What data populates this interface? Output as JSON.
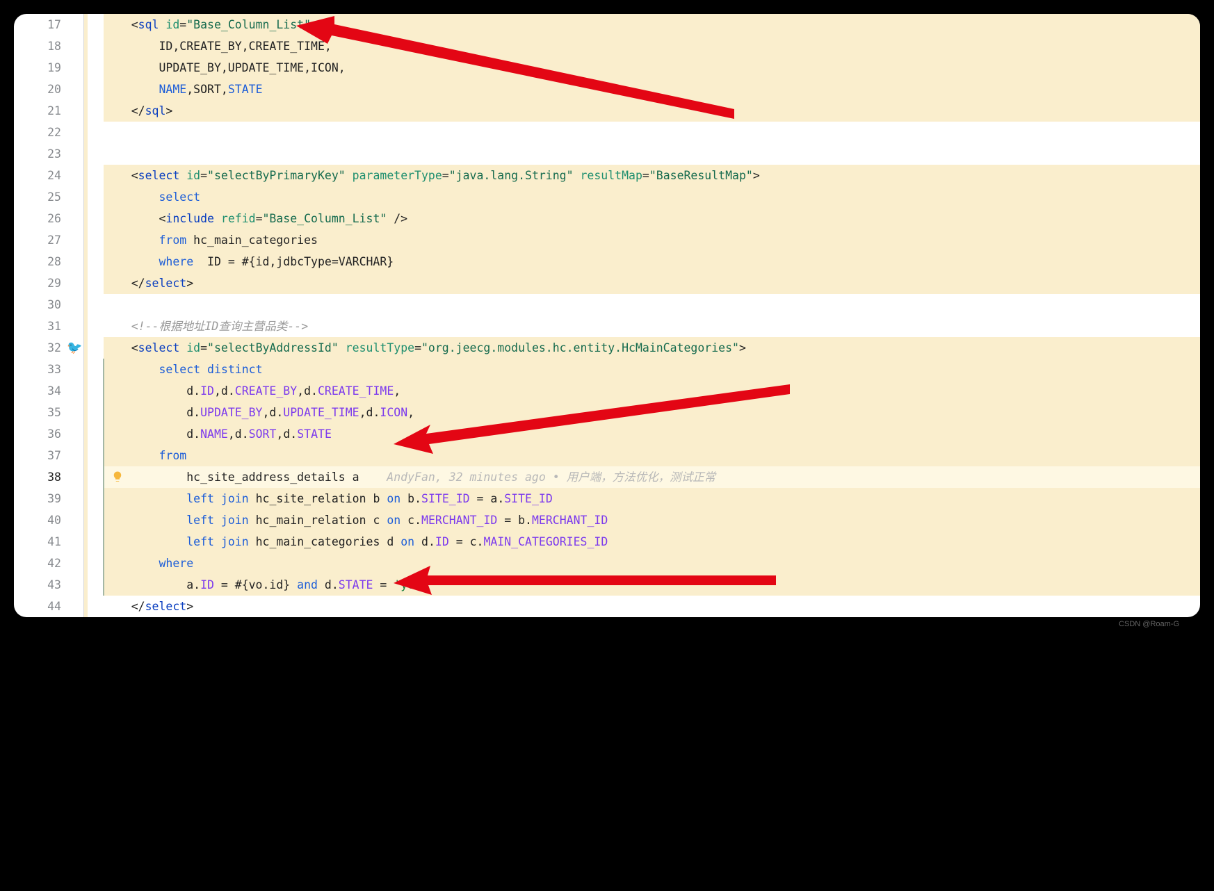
{
  "watermark": "CSDN @Roam-G",
  "gutter": {
    "start": 17,
    "end": 44,
    "bird_line": 32,
    "bulb_line": 38,
    "highlighted_ranges": [
      [
        17,
        21
      ],
      [
        24,
        29
      ],
      [
        32,
        44
      ]
    ],
    "current_line": 38
  },
  "blame": {
    "author": "AndyFan",
    "time": "32 minutes ago",
    "message": "用户端，方法优化，测试正常"
  },
  "code": {
    "lines": [
      {
        "n": 17,
        "hl": 1,
        "tokens": [
          [
            "    <",
            "text"
          ],
          [
            "sql",
            "tag"
          ],
          [
            " ",
            "text"
          ],
          [
            "id",
            "attr"
          ],
          [
            "=",
            "text"
          ],
          [
            "\"Base_Column_List\"",
            "str"
          ],
          [
            ">",
            "text"
          ]
        ]
      },
      {
        "n": 18,
        "hl": 1,
        "tokens": [
          [
            "        ID,CREATE_BY,CREATE_TIME,",
            "text"
          ]
        ]
      },
      {
        "n": 19,
        "hl": 1,
        "tokens": [
          [
            "        UPDATE_BY,UPDATE_TIME,ICON,",
            "text"
          ]
        ]
      },
      {
        "n": 20,
        "hl": 1,
        "tokens": [
          [
            "        ",
            "text"
          ],
          [
            "NAME",
            "kw"
          ],
          [
            ",SORT,",
            "text"
          ],
          [
            "STATE",
            "kw"
          ]
        ]
      },
      {
        "n": 21,
        "hl": 1,
        "tokens": [
          [
            "    </",
            "text"
          ],
          [
            "sql",
            "tag"
          ],
          [
            ">",
            "text"
          ]
        ]
      },
      {
        "n": 22,
        "hl": 0,
        "tokens": [
          [
            "",
            "text"
          ]
        ]
      },
      {
        "n": 23,
        "hl": 0,
        "tokens": [
          [
            "",
            "text"
          ]
        ]
      },
      {
        "n": 24,
        "hl": 1,
        "tokens": [
          [
            "    <",
            "text"
          ],
          [
            "select",
            "tag"
          ],
          [
            " ",
            "text"
          ],
          [
            "id",
            "attr"
          ],
          [
            "=",
            "text"
          ],
          [
            "\"selectByPrimaryKey\"",
            "str"
          ],
          [
            " ",
            "text"
          ],
          [
            "parameterType",
            "attr"
          ],
          [
            "=",
            "text"
          ],
          [
            "\"java.lang.String\"",
            "str"
          ],
          [
            " ",
            "text"
          ],
          [
            "resultMap",
            "attr"
          ],
          [
            "=",
            "text"
          ],
          [
            "\"BaseResultMap\"",
            "str"
          ],
          [
            ">",
            "text"
          ]
        ]
      },
      {
        "n": 25,
        "hl": 1,
        "tokens": [
          [
            "        ",
            "text"
          ],
          [
            "select",
            "kw"
          ]
        ]
      },
      {
        "n": 26,
        "hl": 1,
        "tokens": [
          [
            "        <",
            "text"
          ],
          [
            "include",
            "tag"
          ],
          [
            " ",
            "text"
          ],
          [
            "refid",
            "attr"
          ],
          [
            "=",
            "text"
          ],
          [
            "\"Base_Column_List\"",
            "str"
          ],
          [
            " />",
            "text"
          ]
        ]
      },
      {
        "n": 27,
        "hl": 1,
        "tokens": [
          [
            "        ",
            "text"
          ],
          [
            "from",
            "kw"
          ],
          [
            " hc_main_categories",
            "text"
          ]
        ]
      },
      {
        "n": 28,
        "hl": 1,
        "tokens": [
          [
            "        ",
            "text"
          ],
          [
            "where",
            "kw"
          ],
          [
            "  ID = #{id,jdbcType=VARCHAR}",
            "text"
          ]
        ]
      },
      {
        "n": 29,
        "hl": 1,
        "tokens": [
          [
            "    </",
            "text"
          ],
          [
            "select",
            "tag"
          ],
          [
            ">",
            "text"
          ]
        ]
      },
      {
        "n": 30,
        "hl": 0,
        "tokens": [
          [
            "",
            "text"
          ]
        ]
      },
      {
        "n": 31,
        "hl": 0,
        "tokens": [
          [
            "    ",
            "text"
          ],
          [
            "<!--根据地址ID查询主营品类-->",
            "comment"
          ]
        ]
      },
      {
        "n": 32,
        "hl": 1,
        "tokens": [
          [
            "    <",
            "text"
          ],
          [
            "select",
            "tag"
          ],
          [
            " ",
            "text"
          ],
          [
            "id",
            "attr"
          ],
          [
            "=",
            "text"
          ],
          [
            "\"selectByAddressId\"",
            "str"
          ],
          [
            " ",
            "text"
          ],
          [
            "resultType",
            "attr"
          ],
          [
            "=",
            "text"
          ],
          [
            "\"org.jeecg.modules.hc.entity.HcMainCategories\"",
            "str"
          ],
          [
            ">",
            "text"
          ]
        ]
      },
      {
        "n": 33,
        "hl": 1,
        "tokens": [
          [
            "        ",
            "text"
          ],
          [
            "select",
            "kw"
          ],
          [
            " ",
            "text"
          ],
          [
            "distinct",
            "kw"
          ]
        ]
      },
      {
        "n": 34,
        "hl": 1,
        "tokens": [
          [
            "            d.",
            "text"
          ],
          [
            "ID",
            "field"
          ],
          [
            ",d.",
            "text"
          ],
          [
            "CREATE_BY",
            "field"
          ],
          [
            ",d.",
            "text"
          ],
          [
            "CREATE_TIME",
            "field"
          ],
          [
            ",",
            "text"
          ]
        ]
      },
      {
        "n": 35,
        "hl": 1,
        "tokens": [
          [
            "            d.",
            "text"
          ],
          [
            "UPDATE_BY",
            "field"
          ],
          [
            ",d.",
            "text"
          ],
          [
            "UPDATE_TIME",
            "field"
          ],
          [
            ",d.",
            "text"
          ],
          [
            "ICON",
            "field"
          ],
          [
            ",",
            "text"
          ]
        ]
      },
      {
        "n": 36,
        "hl": 1,
        "tokens": [
          [
            "            d.",
            "text"
          ],
          [
            "NAME",
            "field"
          ],
          [
            ",d.",
            "text"
          ],
          [
            "SORT",
            "field"
          ],
          [
            ",d.",
            "text"
          ],
          [
            "STATE",
            "field"
          ]
        ]
      },
      {
        "n": 37,
        "hl": 1,
        "tokens": [
          [
            "        ",
            "text"
          ],
          [
            "from",
            "kw"
          ]
        ]
      },
      {
        "n": 38,
        "hl": 2,
        "tokens": [
          [
            "            hc_site_address_details a    ",
            "text"
          ]
        ]
      },
      {
        "n": 39,
        "hl": 1,
        "tokens": [
          [
            "            ",
            "text"
          ],
          [
            "left",
            "kw"
          ],
          [
            " ",
            "text"
          ],
          [
            "join",
            "kw"
          ],
          [
            " hc_site_relation b ",
            "text"
          ],
          [
            "on",
            "kw"
          ],
          [
            " b.",
            "text"
          ],
          [
            "SITE_ID",
            "field"
          ],
          [
            " = a.",
            "text"
          ],
          [
            "SITE_ID",
            "field"
          ]
        ]
      },
      {
        "n": 40,
        "hl": 1,
        "tokens": [
          [
            "            ",
            "text"
          ],
          [
            "left",
            "kw"
          ],
          [
            " ",
            "text"
          ],
          [
            "join",
            "kw"
          ],
          [
            " hc_main_relation c ",
            "text"
          ],
          [
            "on",
            "kw"
          ],
          [
            " c.",
            "text"
          ],
          [
            "MERCHANT_ID",
            "field"
          ],
          [
            " = b.",
            "text"
          ],
          [
            "MERCHANT_ID",
            "field"
          ]
        ]
      },
      {
        "n": 41,
        "hl": 1,
        "tokens": [
          [
            "            ",
            "text"
          ],
          [
            "left",
            "kw"
          ],
          [
            " ",
            "text"
          ],
          [
            "join",
            "kw"
          ],
          [
            " hc_main_categories d ",
            "text"
          ],
          [
            "on",
            "kw"
          ],
          [
            " d.",
            "text"
          ],
          [
            "ID",
            "field"
          ],
          [
            " = c.",
            "text"
          ],
          [
            "MAIN_CATEGORIES_ID",
            "field"
          ]
        ]
      },
      {
        "n": 42,
        "hl": 1,
        "tokens": [
          [
            "        ",
            "text"
          ],
          [
            "where",
            "kw"
          ]
        ]
      },
      {
        "n": 43,
        "hl": 1,
        "tokens": [
          [
            "            a.",
            "text"
          ],
          [
            "ID",
            "field"
          ],
          [
            " = #{vo.id} ",
            "text"
          ],
          [
            "and",
            "kw"
          ],
          [
            " d.",
            "text"
          ],
          [
            "STATE",
            "field"
          ],
          [
            " = ",
            "text"
          ],
          [
            "'yes'",
            "strlit"
          ]
        ]
      },
      {
        "n": 44,
        "hl": 0,
        "tokens": [
          [
            "    </",
            "text"
          ],
          [
            "select",
            "tag"
          ],
          [
            ">",
            "text"
          ]
        ]
      }
    ]
  }
}
